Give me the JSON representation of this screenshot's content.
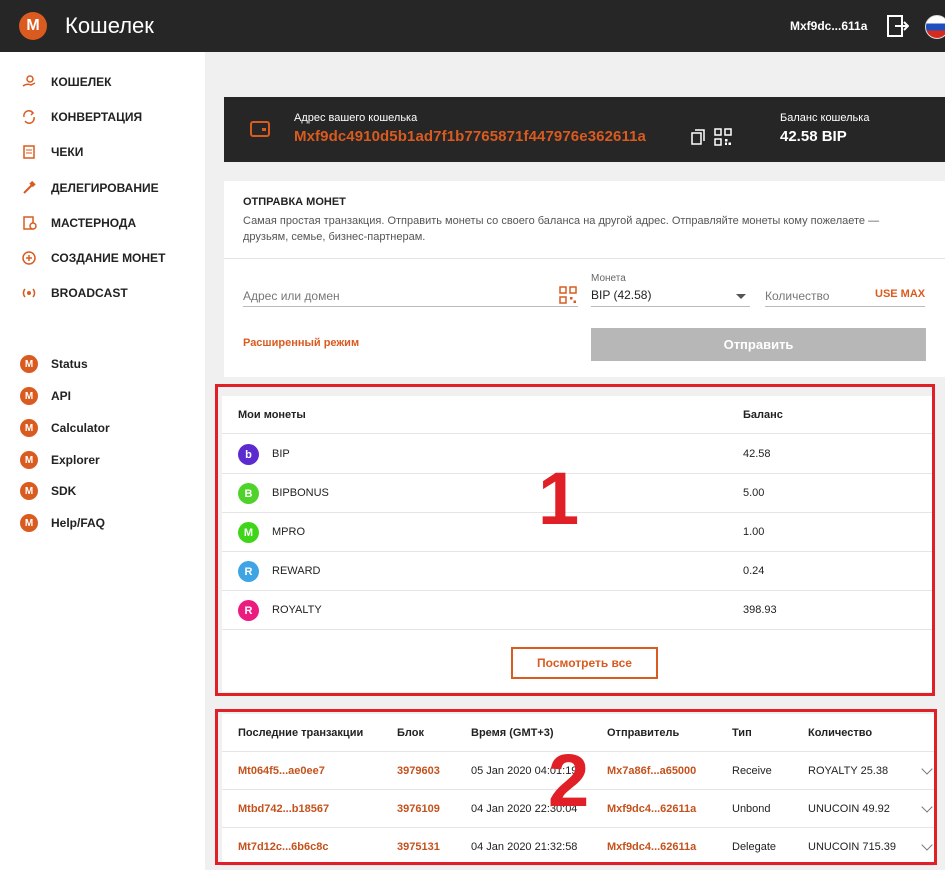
{
  "header": {
    "logo_letter": "M",
    "title": "Кошелек",
    "account": "Mxf9dc...611a"
  },
  "sidebar": {
    "items": [
      {
        "label": "КОШЕЛЕК",
        "icon": "wallet-hand-icon"
      },
      {
        "label": "КОНВЕРТАЦИЯ",
        "icon": "convert-icon"
      },
      {
        "label": "ЧЕКИ",
        "icon": "checks-icon"
      },
      {
        "label": "ДЕЛЕГИРОВАНИЕ",
        "icon": "delegate-icon"
      },
      {
        "label": "МАСТЕРНОДА",
        "icon": "masternode-icon"
      },
      {
        "label": "СОЗДАНИЕ МОНЕТ",
        "icon": "create-coin-icon"
      },
      {
        "label": "BROADCAST",
        "icon": "broadcast-icon"
      }
    ],
    "links": [
      {
        "label": "Status"
      },
      {
        "label": "API"
      },
      {
        "label": "Calculator"
      },
      {
        "label": "Explorer"
      },
      {
        "label": "SDK"
      },
      {
        "label": "Help/FAQ"
      }
    ]
  },
  "wallet": {
    "address_label": "Адрес вашего кошелька",
    "address": "Mxf9dc4910d5b1ad7f1b7765871f447976e362611a",
    "balance_label": "Баланс кошелька",
    "balance": "42.58 BIP"
  },
  "send": {
    "title": "ОТПРАВКА МОНЕТ",
    "description": "Самая простая транзакция. Отправить монеты со своего баланса на другой адрес. Отправляйте монеты кому пожелаете — друзьям, семье, бизнес-партнерам.",
    "address_placeholder": "Адрес или домен",
    "coin_label": "Монета",
    "coin_value": "BIP (42.58)",
    "amount_placeholder": "Количество",
    "use_max": "USE MAX",
    "advanced": "Расширенный режим",
    "submit": "Отправить"
  },
  "coins": {
    "header_name": "Мои монеты",
    "header_balance": "Баланс",
    "rows": [
      {
        "letter": "b",
        "name": "BIP",
        "balance": "42.58",
        "color": "#5b2bcf"
      },
      {
        "letter": "B",
        "name": "BIPBONUS",
        "balance": "5.00",
        "color": "#4fd22a"
      },
      {
        "letter": "M",
        "name": "MPRO",
        "balance": "1.00",
        "color": "#3fd61a"
      },
      {
        "letter": "R",
        "name": "REWARD",
        "balance": "0.24",
        "color": "#3ea4e4"
      },
      {
        "letter": "R",
        "name": "ROYALTY",
        "balance": "398.93",
        "color": "#ec1b7f"
      }
    ],
    "view_all": "Посмотреть все"
  },
  "transactions": {
    "headers": [
      "Последние транзакции",
      "Блок",
      "Время (GMT+3)",
      "Отправитель",
      "Тип",
      "Количество"
    ],
    "rows": [
      {
        "hash": "Mt064f5...ae0ee7",
        "block": "3979603",
        "time": "05 Jan 2020 04:01:19",
        "sender": "Mx7a86f...a65000",
        "type": "Receive",
        "amount": "ROYALTY 25.38"
      },
      {
        "hash": "Mtbd742...b18567",
        "block": "3976109",
        "time": "04 Jan 2020 22:30:04",
        "sender": "Mxf9dc4...62611a",
        "type": "Unbond",
        "amount": "UNUCOIN 49.92"
      },
      {
        "hash": "Mt7d12c...6b6c8c",
        "block": "3975131",
        "time": "04 Jan 2020 21:32:58",
        "sender": "Mxf9dc4...62611a",
        "type": "Delegate",
        "amount": "UNUCOIN 715.39"
      }
    ]
  },
  "annotations": {
    "box1": "1",
    "box2": "2",
    "color": "#e01f26"
  }
}
